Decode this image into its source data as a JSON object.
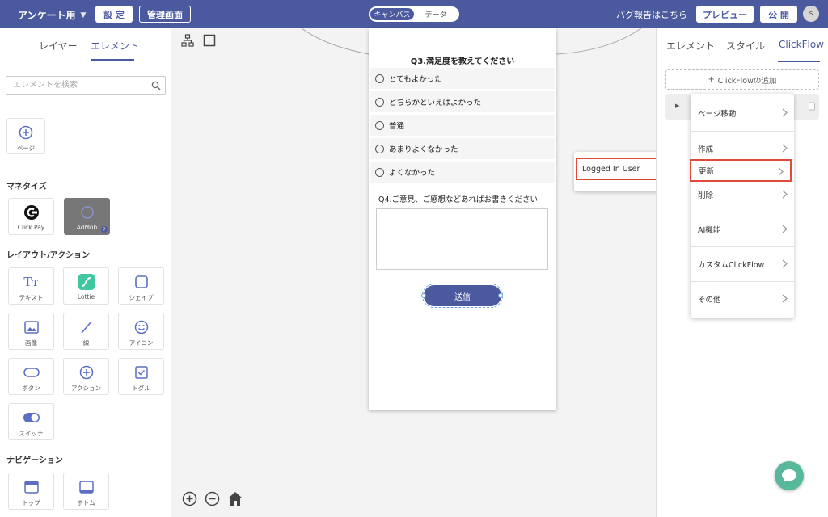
{
  "topbar": {
    "app_title": "アンケート用",
    "settings_label": "設 定",
    "admin_label": "管理画面",
    "mode_options": [
      "キャンバス",
      "データ"
    ],
    "bug_report": "バグ報告はこちら",
    "preview_label": "プレビュー",
    "publish_label": "公 開",
    "avatar_initial": "s"
  },
  "left": {
    "tabs": [
      "レイヤー",
      "エレメント"
    ],
    "active_tab": "エレメント",
    "search_placeholder": "エレメントを検索",
    "page_label": "ページ",
    "sections": {
      "monetize": "マネタイズ",
      "layout": "レイアウト/アクション",
      "navigation": "ナビゲーション"
    },
    "monetize_items": [
      "Click Pay",
      "AdMob"
    ],
    "layout_items": [
      "テキスト",
      "Lottie",
      "シェイプ",
      "画像",
      "線",
      "アイコン",
      "ボタン",
      "アクション",
      "トグル",
      "スイッチ"
    ],
    "nav_items": [
      "トップ",
      "ボトム"
    ]
  },
  "canvas": {
    "question3": "Q3.満足度を教えてください",
    "options": [
      "とてもよかった",
      "どちらかといえばよかった",
      "普通",
      "あまりよくなかった",
      "よくなかった"
    ],
    "question4": "Q4.ご意見、ご感想などあればお書きください",
    "textarea_value": "",
    "submit_label": "送信",
    "submenu_item": "Logged In User"
  },
  "right": {
    "tabs": [
      "エレメント",
      "スタイル",
      "ClickFlow"
    ],
    "active_tab": "ClickFlow",
    "add_clickflow": "ClickFlowの追加",
    "menu_items": [
      "ページ移動",
      "作成",
      "更新",
      "削除",
      "AI機能",
      "カスタムClickFlow",
      "その他"
    ],
    "selected_item": "更新"
  },
  "colors": {
    "brand": "#4b5a9f",
    "highlight": "#e04a3a",
    "chat": "#58b89c"
  }
}
